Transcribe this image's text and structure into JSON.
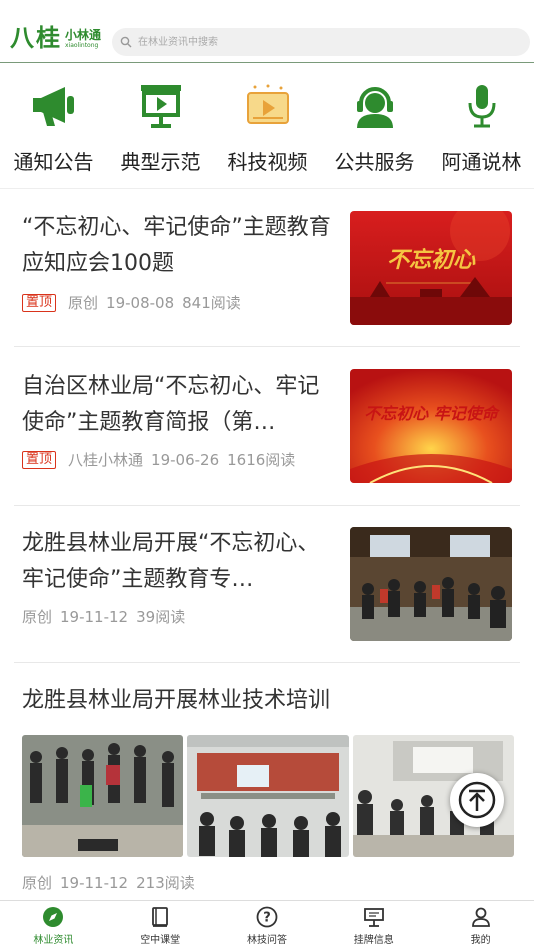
{
  "header": {
    "logo_main": "八桂",
    "logo_sub": "小林通",
    "logo_pinyin": "xiaolintong",
    "search_placeholder": "在林业资讯中搜索"
  },
  "categories": [
    {
      "label": "通知公告",
      "icon": "megaphone-icon"
    },
    {
      "label": "典型示范",
      "icon": "presentation-board-icon"
    },
    {
      "label": "科技视频",
      "icon": "video-icon"
    },
    {
      "label": "公共服务",
      "icon": "customer-service-icon"
    },
    {
      "label": "阿通说林",
      "icon": "microphone-icon"
    }
  ],
  "articles": [
    {
      "title": "“不忘初心、牢记使命”主题教育 应知应会100题",
      "tag": "置顶",
      "source": "原创",
      "date": "19-08-08",
      "reads": "841阅读",
      "thumb_text": "不忘初心"
    },
    {
      "title": "自治区林业局“不忘初心、牢记使命”主题教育简报（第…",
      "tag": "置顶",
      "source": "八桂小林通",
      "date": "19-06-26",
      "reads": "1616阅读",
      "thumb_text": "不忘初心 牢记使命"
    },
    {
      "title": "龙胜县林业局开展“不忘初心、牢记使命”主题教育专…",
      "tag": "",
      "source": "原创",
      "date": "19-11-12",
      "reads": "39阅读"
    },
    {
      "title": "龙胜县林业局开展林业技术培训",
      "tag": "",
      "source": "原创",
      "date": "19-11-12",
      "reads": "213阅读"
    }
  ],
  "tabbar": [
    {
      "label": "林业资讯",
      "icon": "compass-icon",
      "active": true
    },
    {
      "label": "空中课堂",
      "icon": "book-icon",
      "active": false
    },
    {
      "label": "林技问答",
      "icon": "question-icon",
      "active": false
    },
    {
      "label": "挂牌信息",
      "icon": "signboard-icon",
      "active": false
    },
    {
      "label": "我的",
      "icon": "user-icon",
      "active": false
    }
  ],
  "colors": {
    "brand_green": "#2e8b2e",
    "tag_red": "#d9331b"
  }
}
